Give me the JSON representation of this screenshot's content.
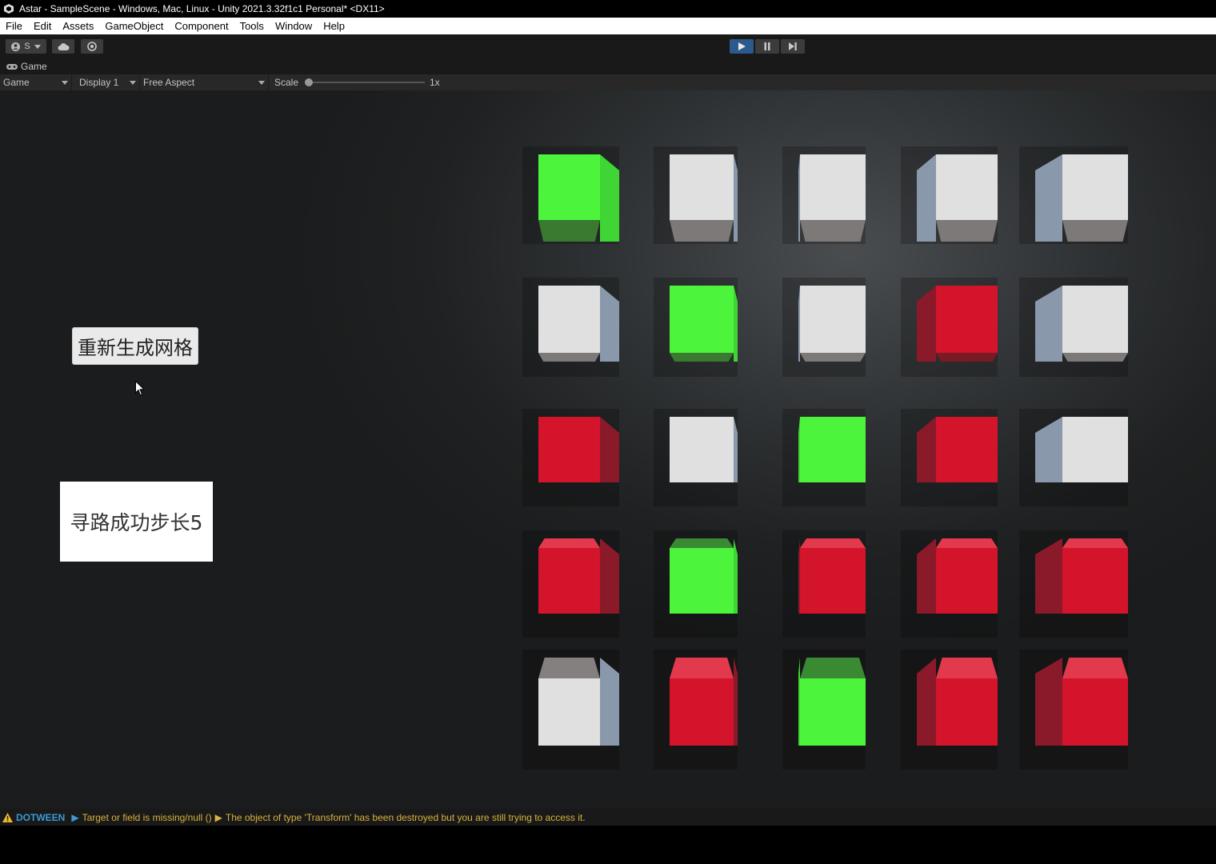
{
  "window": {
    "title": "Astar - SampleScene - Windows, Mac, Linux - Unity 2021.3.32f1c1 Personal* <DX11>"
  },
  "menu": {
    "items": [
      "File",
      "Edit",
      "Assets",
      "GameObject",
      "Component",
      "Tools",
      "Window",
      "Help"
    ]
  },
  "toolbar": {
    "account_label": "S"
  },
  "tab": {
    "label": "Game"
  },
  "gamebar": {
    "mode": "Game",
    "display": "Display 1",
    "aspect": "Free Aspect",
    "scale_label": "Scale",
    "scale_value": "1x"
  },
  "game_ui": {
    "regenerate_button": "重新生成网格",
    "result_text": "寻路成功步长5"
  },
  "grid": {
    "colors": {
      "green": "#4cf53c",
      "white": "#e0e0e0",
      "red": "#d4142a"
    },
    "rows": [
      [
        "green",
        "white",
        "white",
        "white",
        "white"
      ],
      [
        "white",
        "green",
        "white",
        "red",
        "white"
      ],
      [
        "red",
        "white",
        "green",
        "red",
        "white"
      ],
      [
        "red",
        "green",
        "red",
        "red",
        "red"
      ],
      [
        "white",
        "red",
        "green",
        "red",
        "red"
      ]
    ]
  },
  "status": {
    "tag": "DOTWEEN",
    "message_1": "Target or field is missing/null ()",
    "message_2": "The object of type 'Transform' has been destroyed but you are still trying to access it."
  }
}
